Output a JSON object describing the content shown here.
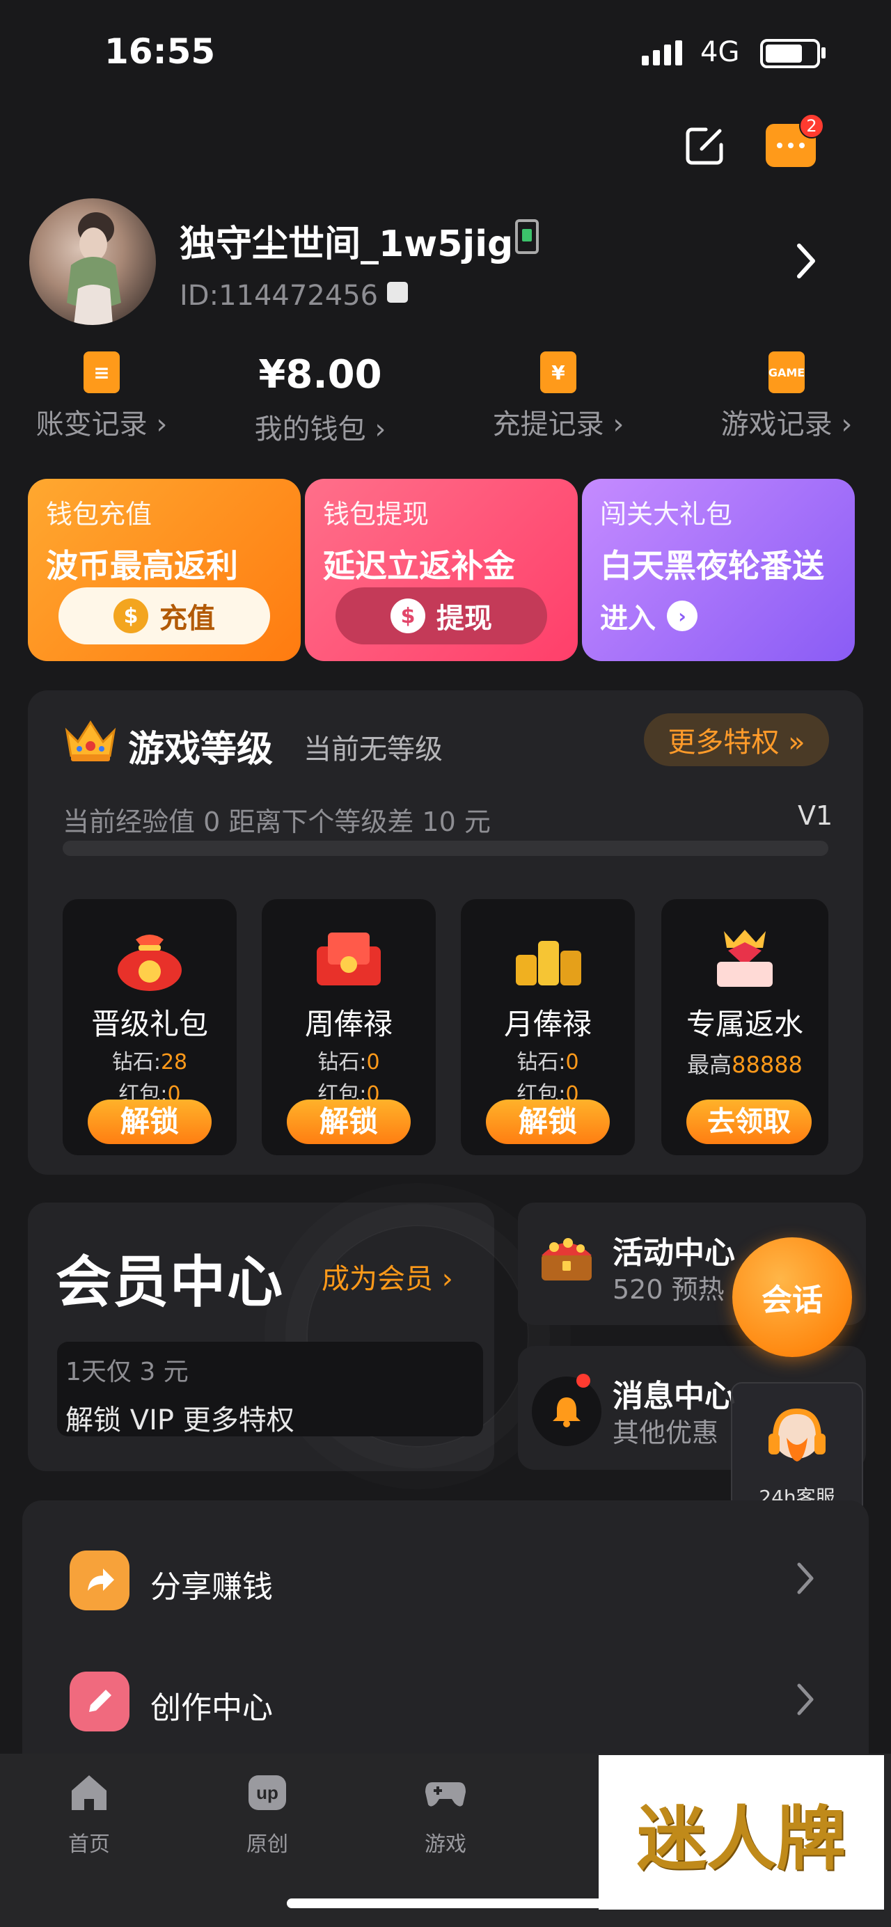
{
  "status": {
    "time": "16:55",
    "network": "4G"
  },
  "header": {
    "badge_count": "2"
  },
  "profile": {
    "name": "独守尘世间_1w5jig",
    "id_text": "ID:114472456"
  },
  "stats": [
    {
      "label": "账变记录 ›",
      "value": "",
      "icon": "ledger-icon"
    },
    {
      "label": "我的钱包 ›",
      "value": "¥8.00",
      "icon": ""
    },
    {
      "label": "充提记录 ›",
      "value": "",
      "icon": "yuan-wallet-icon"
    },
    {
      "label": "游戏记录 ›",
      "value": "",
      "icon": "game-card-icon"
    }
  ],
  "promos": [
    {
      "t1": "钱包充值",
      "t2": "波币最高返利",
      "button": "充值",
      "coin": "$"
    },
    {
      "t1": "钱包提现",
      "t2": "延迟立返补金",
      "button": "提现",
      "coin": "$"
    },
    {
      "t1": "闯关大礼包",
      "t2": "白天黑夜轮番送",
      "button": "进入"
    }
  ],
  "level": {
    "title": "游戏等级",
    "subtitle": "当前无等级",
    "more": "更多特权 »",
    "exp_text": "当前经验值 0 距离下个等级差 10 元",
    "next_level": "V1",
    "progress": 0
  },
  "rewards": [
    {
      "name": "晋级礼包",
      "line1_label": "钻石:",
      "line1_value": "28",
      "line2_label": "红包:",
      "line2_value": "0",
      "button": "解锁"
    },
    {
      "name": "周俸禄",
      "line1_label": "钻石:",
      "line1_value": "0",
      "line2_label": "红包:",
      "line2_value": "0",
      "button": "解锁"
    },
    {
      "name": "月俸禄",
      "line1_label": "钻石:",
      "line1_value": "0",
      "line2_label": "红包:",
      "line2_value": "0",
      "button": "解锁"
    },
    {
      "name": "专属返水",
      "line1_label": "最高",
      "line1_value": "88888",
      "line2_label": "",
      "line2_value": "",
      "button": "去领取"
    }
  ],
  "member": {
    "title": "会员中心",
    "join": "成为会员 ›",
    "line1": "1天仅 3 元",
    "line2": "解锁 VIP 更多特权"
  },
  "activity": {
    "title": "活动中心",
    "sub": "520 预热"
  },
  "messages": {
    "title": "消息中心",
    "sub": "其他优惠"
  },
  "chat_fab": "会话",
  "service_label": "24h客服",
  "menu": [
    {
      "label": "分享赚钱",
      "icon": "share-icon",
      "color": "#f7a23a"
    },
    {
      "label": "创作中心",
      "icon": "pencil-icon",
      "color": "#f06a7e"
    }
  ],
  "nav": [
    {
      "label": "首页",
      "icon": "home-icon"
    },
    {
      "label": "原创",
      "icon": "up-icon"
    },
    {
      "label": "游戏",
      "icon": "gamepad-icon"
    }
  ],
  "brand_text": "迷人牌",
  "colors": {
    "accent": "#ff9a1a",
    "background": "#19191b",
    "panel": "#242427"
  }
}
